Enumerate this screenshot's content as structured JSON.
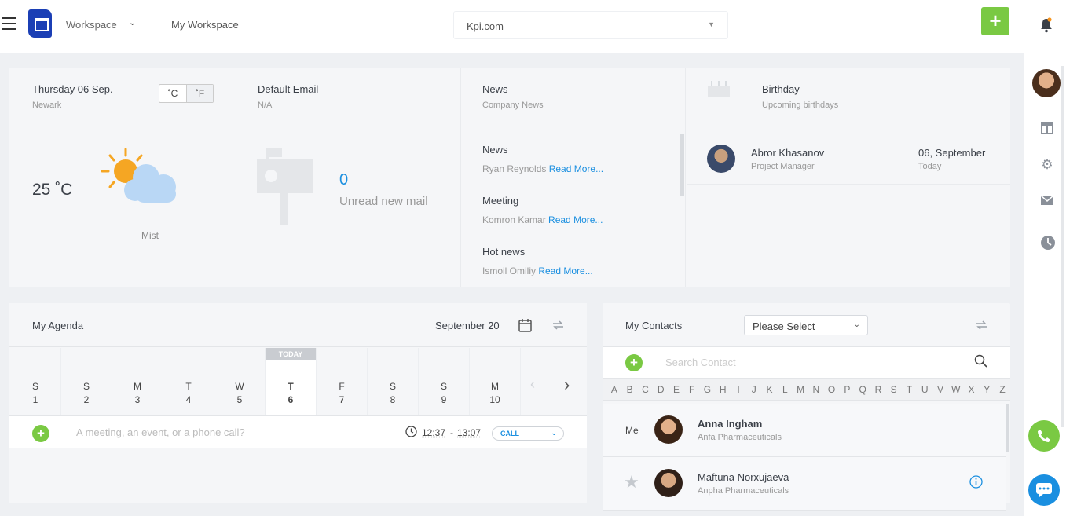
{
  "header": {
    "workspace_label": "Workspace",
    "breadcrumb": "My Workspace",
    "domain_select": "Kpi.com",
    "add_label": "+"
  },
  "weather": {
    "date": "Thursday 06 Sep.",
    "city": "Newark",
    "unit_c": "˚C",
    "unit_f": "˚F",
    "temperature": "25 ˚C",
    "condition": "Mist"
  },
  "email": {
    "title": "Default Email",
    "value": "N/A",
    "unread_count": "0",
    "unread_label": "Unread new mail"
  },
  "news": {
    "title": "News",
    "subtitle": "Company News",
    "items": [
      {
        "title": "News",
        "author": "Ryan Reynolds",
        "link": "Read More..."
      },
      {
        "title": "Meeting",
        "author": "Komron Kamar",
        "link": "Read More..."
      },
      {
        "title": "Hot news",
        "author": "Ismoil Omiliy",
        "link": "Read More..."
      }
    ]
  },
  "birthday": {
    "title": "Birthday",
    "subtitle": "Upcoming birthdays",
    "person": {
      "name": "Abror Khasanov",
      "role": "Project Manager",
      "date": "06, September",
      "when": "Today"
    }
  },
  "agenda": {
    "title": "My Agenda",
    "month": "September 20",
    "today_tag": "TODAY",
    "days": [
      {
        "d": "S",
        "n": "1"
      },
      {
        "d": "S",
        "n": "2"
      },
      {
        "d": "M",
        "n": "3"
      },
      {
        "d": "T",
        "n": "4"
      },
      {
        "d": "W",
        "n": "5"
      },
      {
        "d": "T",
        "n": "6"
      },
      {
        "d": "F",
        "n": "7"
      },
      {
        "d": "S",
        "n": "8"
      },
      {
        "d": "S",
        "n": "9"
      },
      {
        "d": "M",
        "n": "10"
      }
    ],
    "placeholder": "A meeting, an event, or a phone call?",
    "time_from": "12:37",
    "time_sep": "-",
    "time_to": "13:07",
    "type": "CALL"
  },
  "contacts": {
    "title": "My Contacts",
    "filter": "Please Select",
    "search_placeholder": "Search Contact",
    "alphabet": [
      "A",
      "B",
      "C",
      "D",
      "E",
      "F",
      "G",
      "H",
      "I",
      "J",
      "K",
      "L",
      "M",
      "N",
      "O",
      "P",
      "Q",
      "R",
      "S",
      "T",
      "U",
      "V",
      "W",
      "X",
      "Y",
      "Z"
    ],
    "list": [
      {
        "tag": "Me",
        "name": "Anna Ingham",
        "company": "Anfa Pharmaceuticals"
      },
      {
        "tag": "",
        "name": "Maftuna Norxujaeva",
        "company": "Anpha Pharmaceuticals"
      }
    ]
  },
  "colors": {
    "accent_green": "#7ac943",
    "accent_blue": "#1a8fe0",
    "brand_blue": "#1b3fb5"
  }
}
